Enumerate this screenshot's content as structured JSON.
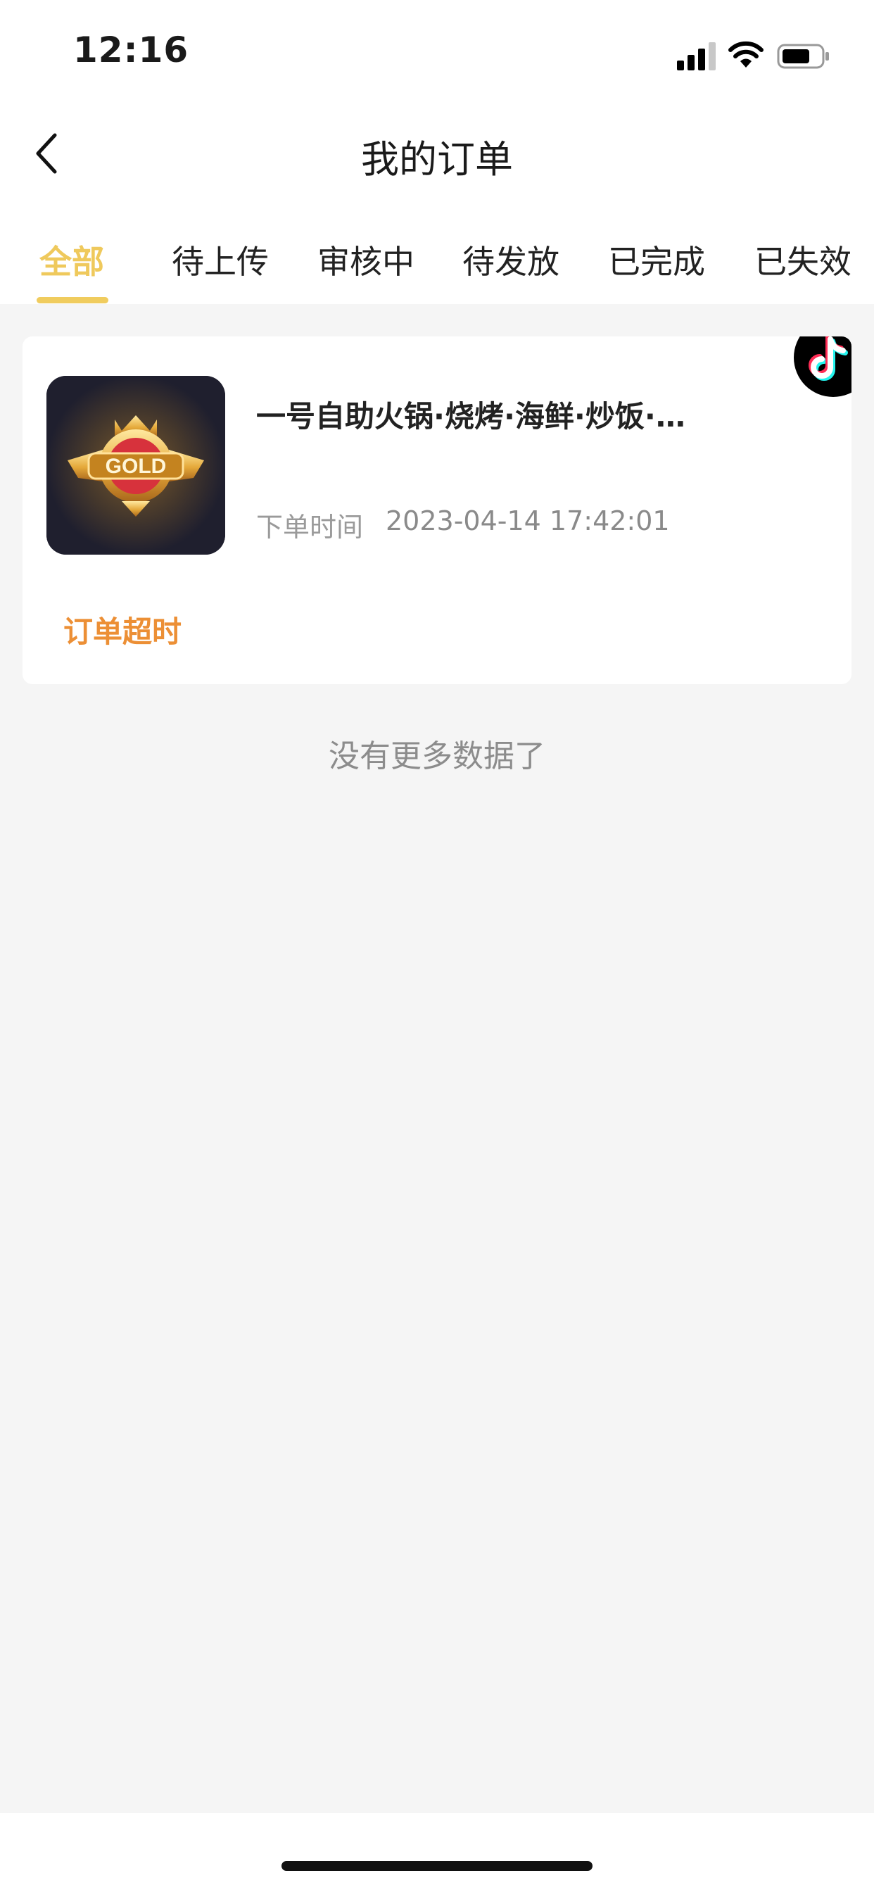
{
  "status_bar": {
    "time": "12:16"
  },
  "nav": {
    "title": "我的订单"
  },
  "tabs": [
    {
      "label": "全部",
      "active": true
    },
    {
      "label": "待上传",
      "active": false
    },
    {
      "label": "审核中",
      "active": false
    },
    {
      "label": "待发放",
      "active": false
    },
    {
      "label": "已完成",
      "active": false
    },
    {
      "label": "已失效",
      "active": false
    }
  ],
  "order": {
    "thumbnail_text": "GOLD",
    "title": "一号自助火锅·烧烤·海鲜·炒饭·…",
    "time_label": "下单时间",
    "time_value": "2023-04-14 17:42:01",
    "status": "订单超时",
    "platform_icon": "tiktok-icon"
  },
  "footer": {
    "no_more_text": "没有更多数据了"
  },
  "colors": {
    "accent": "#efc95c",
    "status_orange": "#ec8f35",
    "background": "#f5f5f5"
  }
}
